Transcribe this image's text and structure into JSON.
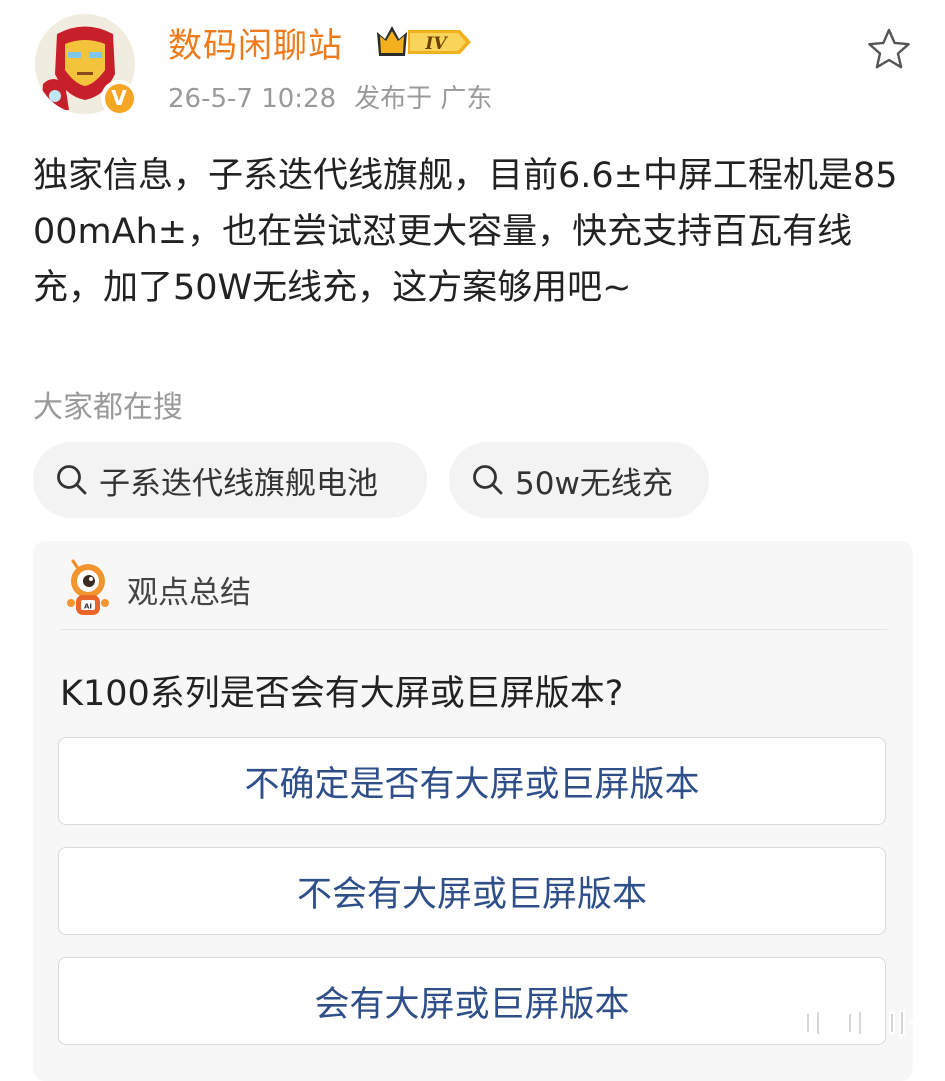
{
  "post": {
    "username": "数码闲聊站",
    "level": "IV",
    "time": "26-5-7 10:28",
    "location": "发布于 广东",
    "content": "独家信息，子系迭代线旗舰，目前6.6±中屏工程机是8500mAh±，也在尝试怼更大容量，快充支持百瓦有线充，加了50W无线充，这方案够用吧~"
  },
  "search": {
    "label": "大家都在搜",
    "chips": [
      "子系迭代线旗舰电池",
      "50w无线充"
    ]
  },
  "summary": {
    "title": "观点总结",
    "question": "K100系列是否会有大屏或巨屏版本?",
    "options": [
      "不确定是否有大屏或巨屏版本",
      "不会有大屏或巨屏版本",
      "会有大屏或巨屏版本"
    ]
  },
  "colors": {
    "username": "#ee7a1a",
    "verified": "#f5a623",
    "option_text": "#2f4f8a",
    "muted": "#9a9a9a"
  },
  "icons": {
    "favorite": "star-outline-icon",
    "search": "magnifier-icon",
    "verified": "verified-v-icon",
    "level": "crown-level-badge-icon",
    "mascot": "ai-mascot-icon"
  }
}
